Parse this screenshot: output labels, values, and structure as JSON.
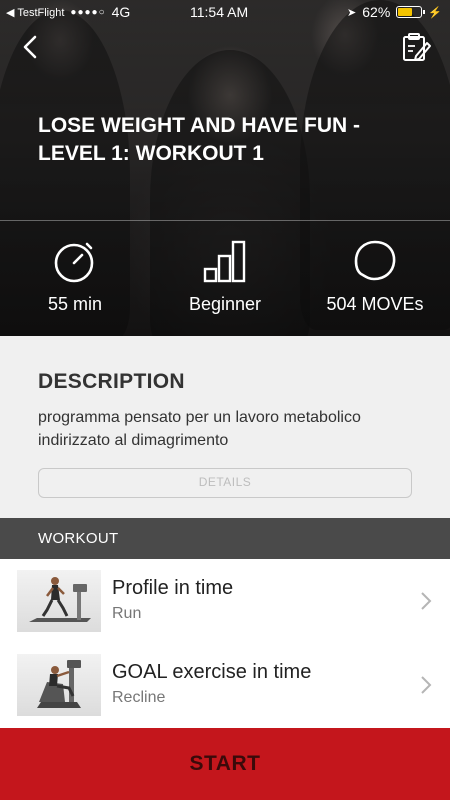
{
  "status_bar": {
    "back_app": "TestFlight",
    "signal_dots": "●●●●○",
    "network": "4G",
    "time": "11:54 AM",
    "battery": "62%",
    "battery_level": 0.62,
    "battery_color": "#f5c400"
  },
  "header": {
    "back_icon": "chevron-left-icon",
    "edit_icon": "edit-note-icon"
  },
  "hero": {
    "title": "LOSE WEIGHT AND HAVE FUN - LEVEL 1: WORKOUT 1",
    "stats": [
      {
        "icon": "stopwatch-icon",
        "value": "55 min"
      },
      {
        "icon": "level-bars-icon",
        "value": "Beginner"
      },
      {
        "icon": "moves-blob-icon",
        "value": "504 MOVEs"
      }
    ]
  },
  "description": {
    "heading": "DESCRIPTION",
    "text": "programma pensato per un lavoro metabolico indirizzato al dimagrimento",
    "details_label": "DETAILS"
  },
  "workout": {
    "heading": "WORKOUT",
    "items": [
      {
        "name": "Profile in time",
        "sub": "Run",
        "thumb_icon": "treadmill-runner-image"
      },
      {
        "name": "GOAL exercise in time",
        "sub": "Recline",
        "thumb_icon": "recumbent-bike-image"
      }
    ]
  },
  "start_label": "START",
  "colors": {
    "accent_red": "#c4161c",
    "section_header": "#4a4a4a",
    "description_bg": "#f0f0f0"
  }
}
